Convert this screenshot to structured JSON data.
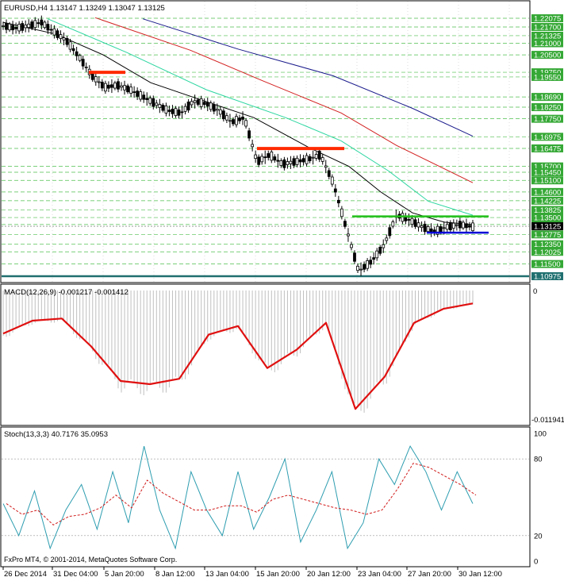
{
  "price_panel": {
    "header": "EURUSD,H4  1.13147 1.13249 1.13047 1.13125",
    "price_labels": [
      "1.22075",
      "1.21700",
      "1.21325",
      "1.21000",
      "1.20500",
      "1.19750",
      "1.19550",
      "1.18690",
      "1.18250",
      "1.17750",
      "1.16975",
      "1.16475",
      "1.15700",
      "1.15450",
      "1.15100",
      "1.14600",
      "1.14225",
      "1.13825",
      "1.13500",
      "1.13200",
      "1.12775",
      "1.12350",
      "1.12025",
      "1.11500"
    ],
    "current_price": "1.13125",
    "low_label": "1.10975",
    "colors": {
      "candles": "#000000",
      "ma_fast": "#000000",
      "ma_mid": "#2bd6a0",
      "ma_slow": "#d32020",
      "ma_long": "#1a1a8c",
      "resistance_red": "#ff2a00",
      "support_green": "#22c01a",
      "support_blue": "#0000d8",
      "teal_line": "#207070",
      "grid": "#4fbf4f"
    }
  },
  "macd_panel": {
    "header": "MACD(12,26,9) -0.001217 -0.001412",
    "top_label": "0",
    "bottom_label": "-0.011941",
    "signal_color": "#e01010",
    "hist_color": "#bfbfbf"
  },
  "stoch_panel": {
    "header": "Stoch(13,3,3) 40.7176 35.0953",
    "levels": [
      "100",
      "80",
      "20",
      "0"
    ],
    "main_color": "#2d9db0",
    "signal_color": "#d11a1a"
  },
  "time_axis": [
    "26 Dec 2014",
    "31 Dec 04:00",
    "5 Jan 20:00",
    "8 Jan 12:00",
    "13 Jan 04:00",
    "15 Jan 20:00",
    "20 Jan 12:00",
    "23 Jan 04:00",
    "27 Jan 20:00",
    "30 Jan 12:00"
  ],
  "copyright": "FxPro MT4, © 2001-2014, MetaQuotes Software Corp.",
  "chart_data": {
    "type": "line",
    "title": "EURUSD,H4",
    "x": [
      "26 Dec 2014",
      "31 Dec 04:00",
      "5 Jan 20:00",
      "8 Jan 12:00",
      "13 Jan 04:00",
      "15 Jan 20:00",
      "20 Jan 12:00",
      "23 Jan 04:00",
      "27 Jan 20:00",
      "30 Jan 12:00"
    ],
    "series": [],
    "ylim": [
      1.10975,
      1.22075
    ],
    "price_path": [
      1.2175,
      1.2165,
      1.2175,
      1.219,
      1.215,
      1.211,
      1.204,
      1.196,
      1.191,
      1.192,
      1.19,
      1.187,
      1.184,
      1.181,
      1.18,
      1.185,
      1.184,
      1.181,
      1.176,
      1.178,
      1.159,
      1.162,
      1.158,
      1.159,
      1.16,
      1.162,
      1.15,
      1.131,
      1.112,
      1.116,
      1.123,
      1.136,
      1.134,
      1.131,
      1.129,
      1.131,
      1.132,
      1.131
    ],
    "macd_signal": [
      -0.004,
      -0.0028,
      -0.0026,
      -0.0052,
      -0.0084,
      -0.0087,
      -0.0082,
      -0.0041,
      -0.0033,
      -0.0072,
      -0.0055,
      -0.003,
      -0.011,
      -0.008,
      -0.003,
      -0.0017,
      -0.0012
    ],
    "stoch_main": [
      45,
      20,
      55,
      10,
      40,
      60,
      25,
      70,
      30,
      90,
      40,
      10,
      70,
      40,
      20,
      70,
      25,
      50,
      80,
      15,
      40,
      70,
      10,
      30,
      80,
      60,
      90,
      70,
      40,
      70,
      45
    ],
    "stoch_levels": [
      100,
      80,
      20,
      0
    ]
  }
}
